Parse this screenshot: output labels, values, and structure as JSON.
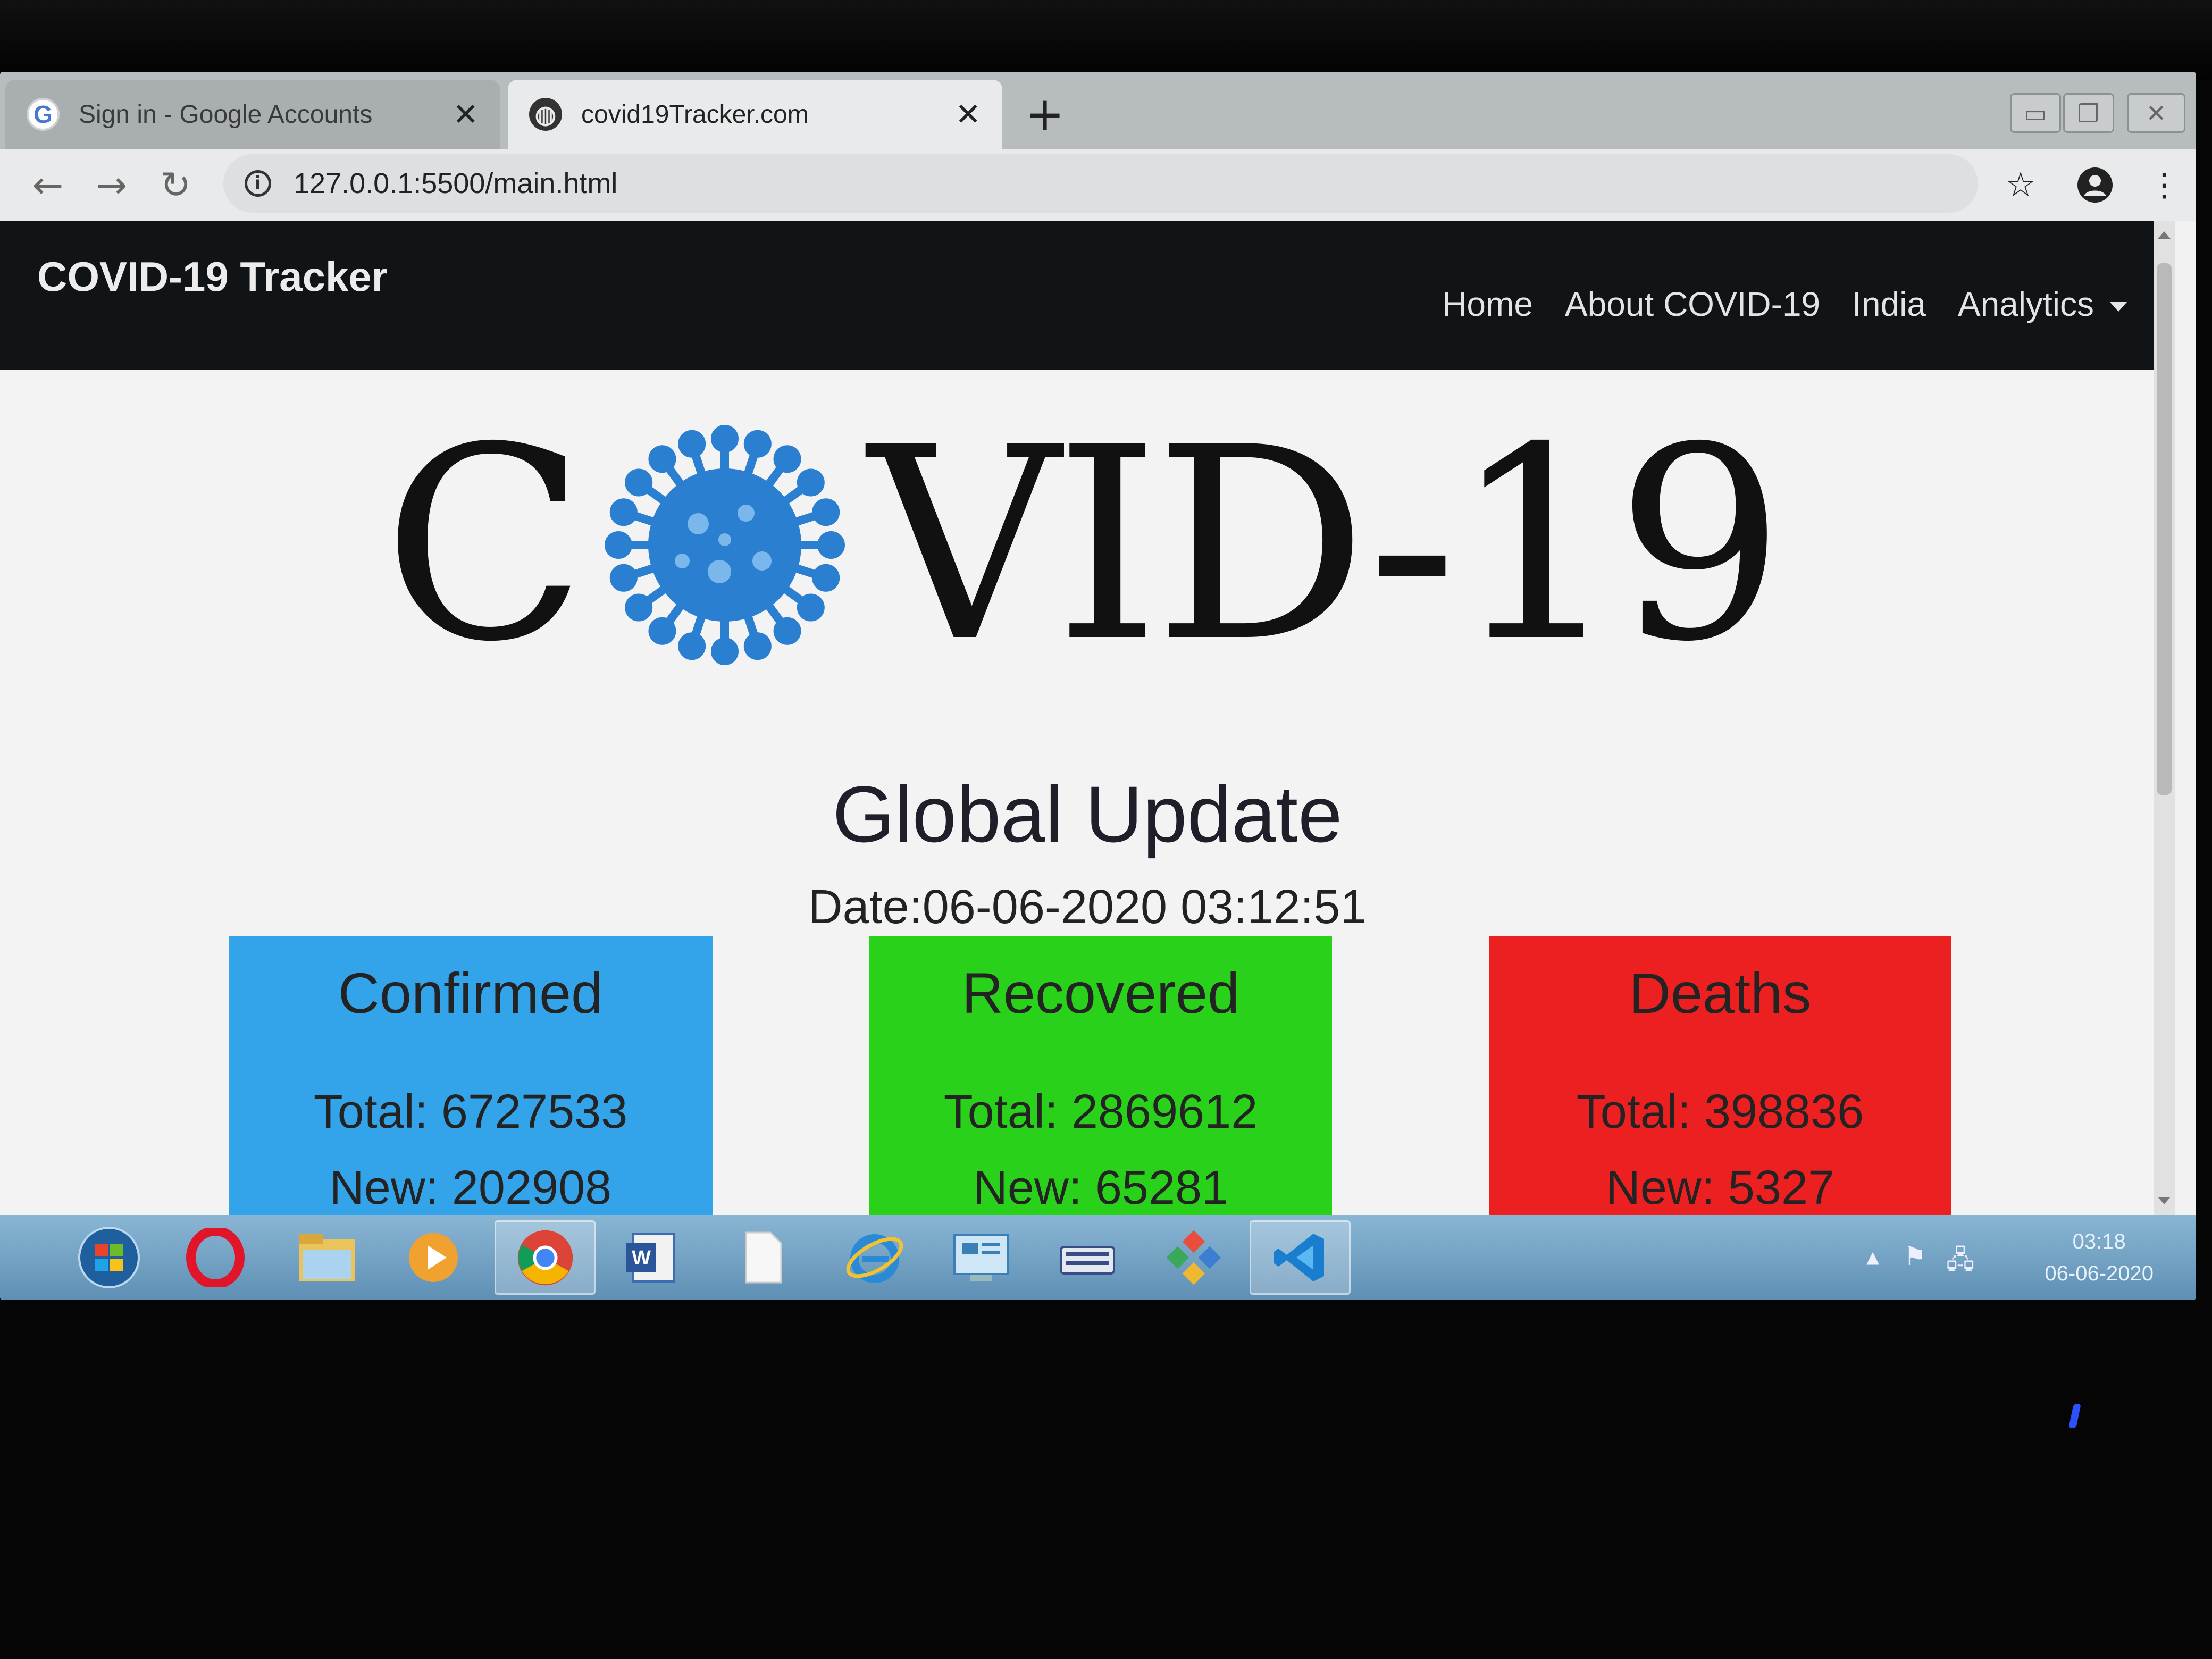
{
  "browser": {
    "tabs": [
      {
        "title": "Sign in - Google Accounts",
        "favicon": "google-g-icon",
        "active": false
      },
      {
        "title": "covid19Tracker.com",
        "favicon": "globe-icon",
        "active": true
      }
    ],
    "new_tab": "+",
    "address": "127.0.0.1:5500/main.html"
  },
  "navbar": {
    "brand": "COVID-19 Tracker",
    "links": [
      "Home",
      "About COVID-19",
      "India",
      "Analytics"
    ]
  },
  "hero": {
    "left": "C",
    "right": "VID-19"
  },
  "global": {
    "title": "Global Update",
    "date": "Date:06-06-2020 03:12:51"
  },
  "cards": [
    {
      "title": "Confirmed",
      "total": "Total: 6727533",
      "new": "New: 202908",
      "color": "#34a4ea"
    },
    {
      "title": "Recovered",
      "total": "Total: 2869612",
      "new": "New: 65281",
      "color": "#2ad11b"
    },
    {
      "title": "Deaths",
      "total": "Total: 398836",
      "new": "New: 5327",
      "color": "#ec2020"
    }
  ],
  "taskbar": {
    "clock_time": "03:18",
    "clock_date": "06-06-2020",
    "apps": [
      "windows-start-icon",
      "opera-icon",
      "folder-icon",
      "media-player-icon",
      "chrome-icon",
      "word-icon",
      "file-icon",
      "internet-explorer-icon",
      "control-panel-icon",
      "keyboard-icon",
      "paint-icon",
      "vscode-icon"
    ]
  }
}
